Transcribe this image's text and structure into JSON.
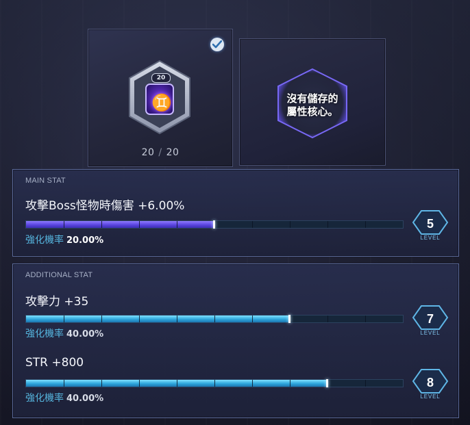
{
  "cards": {
    "equipped": {
      "level": "20",
      "current": "20",
      "max": "20",
      "checked": true,
      "icon": "gemini-symbol-icon",
      "glyph": "♊"
    },
    "saved": {
      "empty_line1": "沒有儲存的",
      "empty_line2": "屬性核心。"
    }
  },
  "main_stat": {
    "title": "MAIN STAT",
    "name": "攻擊Boss怪物時傷害 +6.00%",
    "rate_label": "強化機率",
    "rate_value": "20.00%",
    "progress": 0.5,
    "level": "5",
    "level_word": "LEVEL"
  },
  "additional_stat": {
    "title": "ADDITIONAL STAT",
    "stats": [
      {
        "name": "攻擊力 +35",
        "rate_label": "強化機率",
        "rate_value": "40.00%",
        "progress": 0.7,
        "level": "7",
        "level_word": "LEVEL"
      },
      {
        "name": "STR +800",
        "rate_label": "強化機率",
        "rate_value": "40.00%",
        "progress": 0.8,
        "level": "8",
        "level_word": "LEVEL"
      }
    ]
  },
  "colors": {
    "main_bar": "#5b46e0",
    "additional_bar": "#2fa6dc",
    "rate_label": "#55b4dd",
    "panel_border": "#5b6a9a"
  }
}
